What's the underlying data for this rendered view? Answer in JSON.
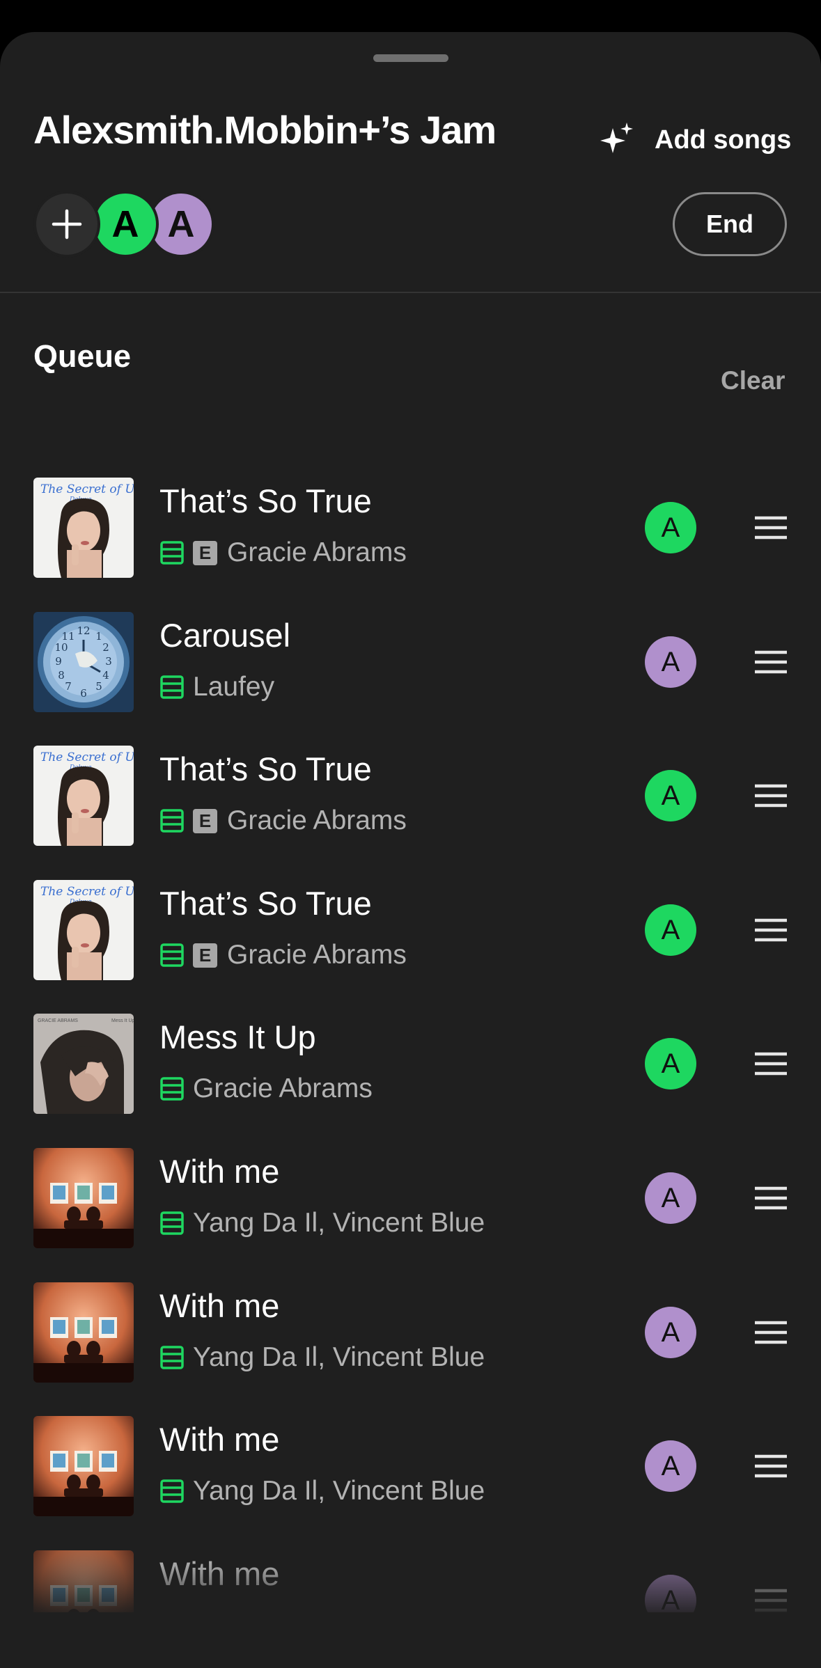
{
  "header": {
    "title": "Alexsmith.Mobbin+’s Jam",
    "add_songs_label": "Add songs",
    "add_songs_icon": "sparkle-icon",
    "end_label": "End"
  },
  "participants": [
    {
      "initial": "A",
      "color": "#1ed760"
    },
    {
      "initial": "A",
      "color": "#b090cc"
    }
  ],
  "queue": {
    "heading": "Queue",
    "clear_label": "Clear",
    "items": [
      {
        "title": "That’s So True",
        "artist": "Gracie Abrams",
        "explicit": true,
        "explicit_label": "E",
        "downloaded": true,
        "added_by": "A",
        "added_by_color": "green",
        "art": "secret-of-us"
      },
      {
        "title": "Carousel",
        "artist": "Laufey",
        "explicit": false,
        "explicit_label": "",
        "downloaded": true,
        "added_by": "A",
        "added_by_color": "purple",
        "art": "clock"
      },
      {
        "title": "That’s So True",
        "artist": "Gracie Abrams",
        "explicit": true,
        "explicit_label": "E",
        "downloaded": true,
        "added_by": "A",
        "added_by_color": "green",
        "art": "secret-of-us"
      },
      {
        "title": "That’s So True",
        "artist": "Gracie Abrams",
        "explicit": true,
        "explicit_label": "E",
        "downloaded": true,
        "added_by": "A",
        "added_by_color": "green",
        "art": "secret-of-us"
      },
      {
        "title": "Mess It Up",
        "artist": "Gracie Abrams",
        "explicit": false,
        "explicit_label": "",
        "downloaded": true,
        "added_by": "A",
        "added_by_color": "green",
        "art": "mess-it-up"
      },
      {
        "title": "With me",
        "artist": "Yang Da Il, Vincent Blue",
        "explicit": false,
        "explicit_label": "",
        "downloaded": true,
        "added_by": "A",
        "added_by_color": "purple",
        "art": "gallery"
      },
      {
        "title": "With me",
        "artist": "Yang Da Il, Vincent Blue",
        "explicit": false,
        "explicit_label": "",
        "downloaded": true,
        "added_by": "A",
        "added_by_color": "purple",
        "art": "gallery"
      },
      {
        "title": "With me",
        "artist": "Yang Da Il, Vincent Blue",
        "explicit": false,
        "explicit_label": "",
        "downloaded": true,
        "added_by": "A",
        "added_by_color": "purple",
        "art": "gallery"
      },
      {
        "title": "With me",
        "artist": "",
        "explicit": false,
        "explicit_label": "",
        "downloaded": false,
        "added_by": "A",
        "added_by_color": "purple",
        "art": "gallery"
      }
    ]
  },
  "colors": {
    "accent": "#1ed760",
    "purple": "#b090cc",
    "background": "#1f1f1f"
  }
}
